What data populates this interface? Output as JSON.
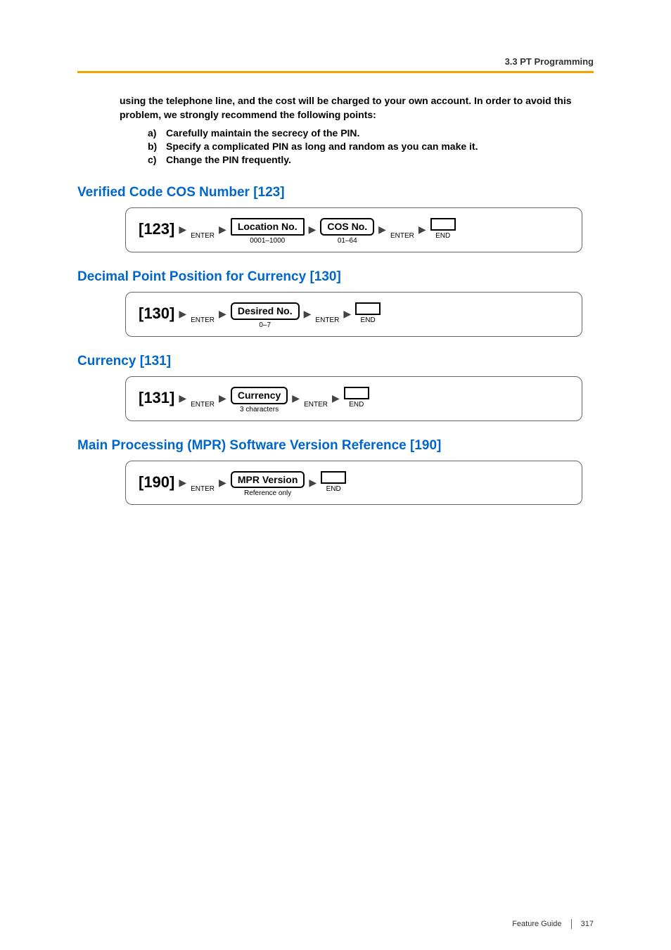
{
  "header": {
    "breadcrumb": "3.3 PT Programming"
  },
  "intro": {
    "line": "using the telephone line, and the cost will be charged to your own account. In order to avoid this problem, we strongly recommend the following points:",
    "items": [
      {
        "label": "a)",
        "text": "Carefully maintain the secrecy of the PIN."
      },
      {
        "label": "b)",
        "text": "Specify a complicated PIN as long and random as you can make it."
      },
      {
        "label": "c)",
        "text": "Change the PIN frequently."
      }
    ]
  },
  "sections": {
    "s123": {
      "title": "Verified Code COS Number [123]",
      "code": "[123]",
      "enter": "ENTER",
      "loc_label": "Location No.",
      "loc_range": "0001–1000",
      "cos_label": "COS No.",
      "cos_range": "01–64",
      "end": "END"
    },
    "s130": {
      "title": "Decimal Point Position for Currency [130]",
      "code": "[130]",
      "enter": "ENTER",
      "desired_label": "Desired No.",
      "desired_range": "0–7",
      "end": "END"
    },
    "s131": {
      "title": "Currency [131]",
      "code": "[131]",
      "enter": "ENTER",
      "currency_label": "Currency",
      "currency_note": "3 characters",
      "end": "END"
    },
    "s190": {
      "title": "Main Processing (MPR) Software Version Reference [190]",
      "code": "[190]",
      "enter": "ENTER",
      "mpr_label": "MPR Version",
      "mpr_note": "Reference only",
      "end": "END"
    }
  },
  "footer": {
    "guide": "Feature Guide",
    "page": "317"
  }
}
